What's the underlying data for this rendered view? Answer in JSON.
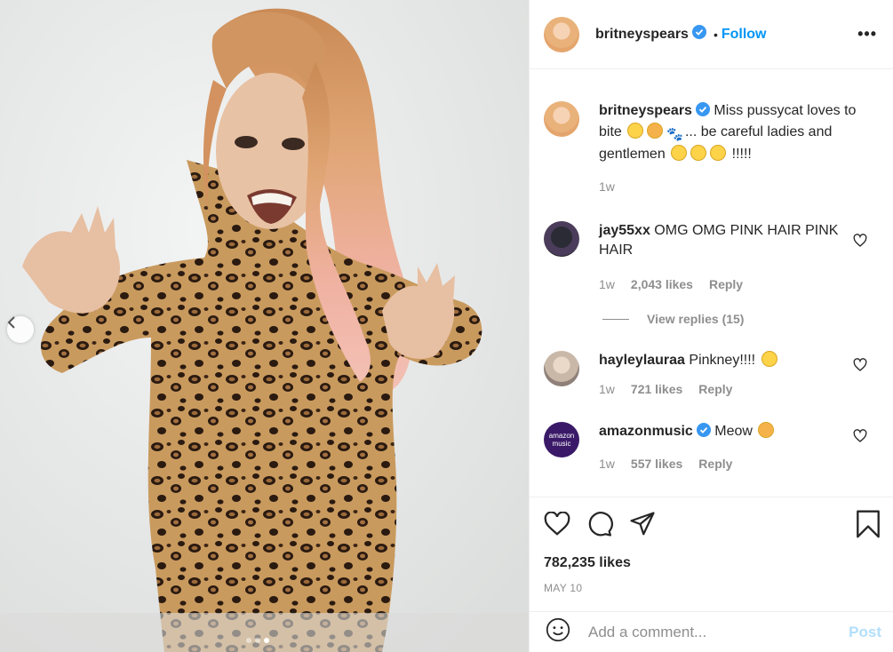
{
  "post": {
    "author": "britneyspears",
    "follow_sep": "•",
    "follow_label": "Follow",
    "more_label": "•••",
    "caption_text": "Miss pussycat loves to bite",
    "caption_text2": "... be careful ladies and gentlemen",
    "caption_tail": "!!!!!",
    "caption_time": "1w"
  },
  "comments": [
    {
      "user": "jay55xx",
      "text": "OMG OMG PINK HAIR PINK HAIR",
      "time": "1w",
      "likes": "2,043 likes",
      "reply": "Reply",
      "view_replies": "View replies (15)"
    },
    {
      "user": "hayleylauraa",
      "text": "Pinkney!!!!",
      "time": "1w",
      "likes": "721 likes",
      "reply": "Reply"
    },
    {
      "user": "amazonmusic",
      "text": "Meow",
      "time": "1w",
      "likes": "557 likes",
      "reply": "Reply",
      "avatar_text1": "amazon",
      "avatar_text2": "music"
    }
  ],
  "actions": {
    "likes": "782,235 likes",
    "date": "MAY 10"
  },
  "composer": {
    "placeholder": "Add a comment...",
    "post_label": "Post"
  },
  "colors": {
    "accent": "#0095f6",
    "verified": "#3897f0",
    "post_disabled": "#b2dffc"
  },
  "icons": [
    "chevron-left-icon",
    "verified-icon",
    "heart-icon",
    "comment-icon",
    "share-icon",
    "bookmark-icon",
    "emoji-icon"
  ],
  "carousel": {
    "count": 3,
    "active": 3
  }
}
